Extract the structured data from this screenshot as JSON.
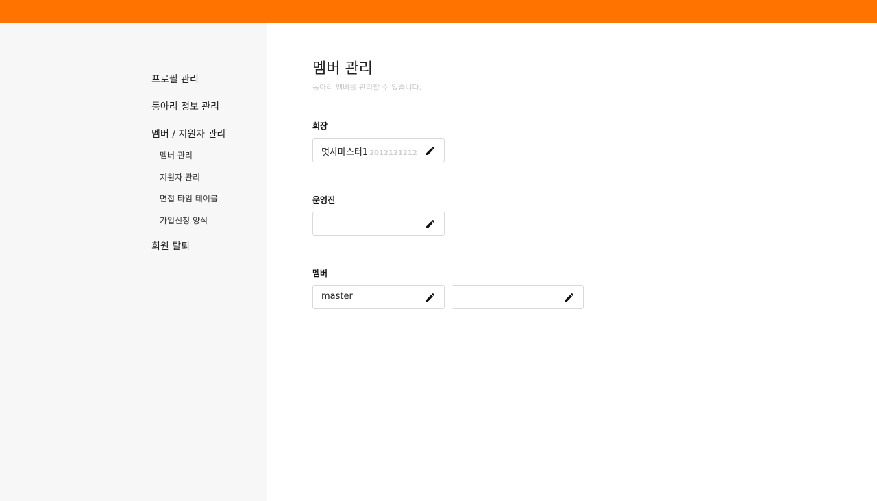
{
  "sidebar": {
    "items": [
      {
        "label": "프로필 관리"
      },
      {
        "label": "동아리 정보 관리"
      },
      {
        "label": "멤버 / 지원자 관리"
      },
      {
        "label": "회원 탈퇴"
      }
    ],
    "sub_items": [
      {
        "label": "멤버 관리"
      },
      {
        "label": "지원자 관리"
      },
      {
        "label": "면접 타임 테이블"
      },
      {
        "label": "가입신청 양식"
      }
    ]
  },
  "main": {
    "title": "멤버 관리",
    "subtitle": "동아리 멤버를 관리할 수 있습니다.",
    "sections": {
      "president": {
        "label": "회장",
        "name": "멋사마스터1",
        "id": "2012121212"
      },
      "staff": {
        "label": "운영진",
        "name": ""
      },
      "members": {
        "label": "멤버",
        "fields": [
          {
            "name": "master"
          },
          {
            "name": ""
          }
        ]
      }
    }
  },
  "colors": {
    "accent": "#ff7300",
    "sidebar_bg": "#f7f7f7",
    "border": "#d9d9d9",
    "muted_text": "#c8c8c8"
  },
  "icons": {
    "edit": "pencil-icon"
  }
}
